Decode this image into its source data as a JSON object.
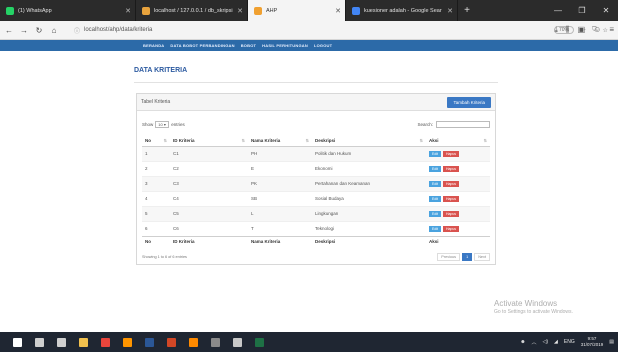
{
  "browser": {
    "tabs": [
      {
        "title": "(1) WhatsApp",
        "color": "#25d366",
        "active": false
      },
      {
        "title": "localhost / 127.0.0.1 / db_skripsi",
        "color": "#e8a33d",
        "active": false
      },
      {
        "title": "AHP",
        "color": "#f0a030",
        "active": true
      },
      {
        "title": "kuesioner adalah - Google Sear",
        "color": "#4285f4",
        "active": false
      }
    ],
    "new_tab": "+",
    "url": "localhost/ahp/data/kriteria",
    "zoom": "70%",
    "icons": [
      "back-icon",
      "forward-icon",
      "reload-icon",
      "home-icon",
      "info-icon",
      "more-icon",
      "pocket-icon",
      "bookmark-star-icon",
      "download-icon",
      "library-icon",
      "sidebar-icon",
      "menu-icon"
    ]
  },
  "app_menu": [
    "BERANDA",
    "DATA BOBOT PERBANDINGAN",
    "BOBOT",
    "HASIL PERHITUNGAN",
    "LOGOUT"
  ],
  "page": {
    "title": "DATA KRITERIA",
    "panel_label": "Tabel Kriteria",
    "add_button": "Tambah Kriteria",
    "show_prefix": "Show",
    "show_value": "10",
    "show_suffix": "entries",
    "search_label": "Search:",
    "columns": [
      "No",
      "ID Kriteria",
      "Nama Kriteria",
      "Deskripsi",
      "Aksi"
    ],
    "rows": [
      {
        "no": "1",
        "id": "C1",
        "nama": "PH",
        "desk": "Politik dan Hukum"
      },
      {
        "no": "2",
        "id": "C2",
        "nama": "E",
        "desk": "Ekonomi"
      },
      {
        "no": "3",
        "id": "C3",
        "nama": "PK",
        "desk": "Pertahanan dan Keamanan"
      },
      {
        "no": "4",
        "id": "C4",
        "nama": "SB",
        "desk": "Sosial Budaya"
      },
      {
        "no": "5",
        "id": "C5",
        "nama": "L",
        "desk": "Lingkungan"
      },
      {
        "no": "6",
        "id": "C6",
        "nama": "T",
        "desk": "Teknologi"
      }
    ],
    "edit_label": "Edit",
    "delete_label": "Hapus",
    "info": "Showing 1 to 6 of 6 entries",
    "pager": {
      "prev": "Previous",
      "page": "1",
      "next": "Next"
    }
  },
  "watermark": {
    "line1": "Activate Windows",
    "line2": "Go to Settings to activate Windows."
  },
  "taskbar": {
    "apps": [
      {
        "name": "windows-start-icon",
        "color": "#ffffff"
      },
      {
        "name": "search-icon",
        "color": "#cfcfcf"
      },
      {
        "name": "task-view-icon",
        "color": "#cfcfcf"
      },
      {
        "name": "explorer-icon",
        "color": "#f2c14e"
      },
      {
        "name": "chrome-icon",
        "color": "#e8453c"
      },
      {
        "name": "firefox-icon",
        "color": "#ff9500"
      },
      {
        "name": "word-icon",
        "color": "#2b5797"
      },
      {
        "name": "powerpoint-icon",
        "color": "#d24726"
      },
      {
        "name": "sublime-icon",
        "color": "#ff8a00"
      },
      {
        "name": "obs-icon",
        "color": "#8a8a8a"
      },
      {
        "name": "paint-icon",
        "color": "#c8c8c8"
      },
      {
        "name": "excel-icon",
        "color": "#1e7145"
      }
    ],
    "tray_lang": "ENG",
    "time": "9:57",
    "date": "31/07/2019"
  }
}
